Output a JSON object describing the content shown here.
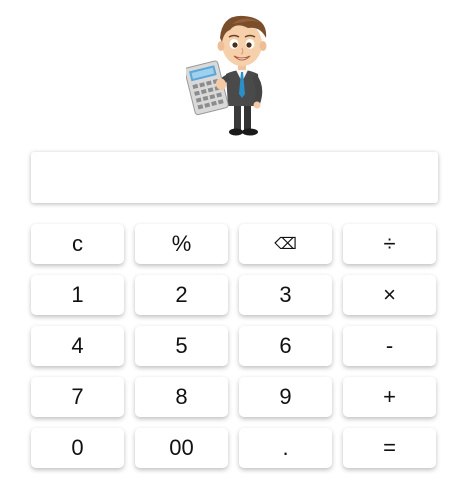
{
  "mascot": {
    "icon": "businessman-with-calculator-icon"
  },
  "display": {
    "value": ""
  },
  "keys": [
    {
      "label": "c",
      "name": "clear-button"
    },
    {
      "label": "%",
      "name": "percent-button"
    },
    {
      "label": "⌫",
      "name": "backspace-button"
    },
    {
      "label": "÷",
      "name": "divide-button"
    },
    {
      "label": "1",
      "name": "digit-1-button"
    },
    {
      "label": "2",
      "name": "digit-2-button"
    },
    {
      "label": "3",
      "name": "digit-3-button"
    },
    {
      "label": "×",
      "name": "multiply-button"
    },
    {
      "label": "4",
      "name": "digit-4-button"
    },
    {
      "label": "5",
      "name": "digit-5-button"
    },
    {
      "label": "6",
      "name": "digit-6-button"
    },
    {
      "label": "-",
      "name": "subtract-button"
    },
    {
      "label": "7",
      "name": "digit-7-button"
    },
    {
      "label": "8",
      "name": "digit-8-button"
    },
    {
      "label": "9",
      "name": "digit-9-button"
    },
    {
      "label": "+",
      "name": "add-button"
    },
    {
      "label": "0",
      "name": "digit-0-button"
    },
    {
      "label": "00",
      "name": "double-zero-button"
    },
    {
      "label": ".",
      "name": "decimal-point-button"
    },
    {
      "label": "=",
      "name": "equals-button"
    }
  ]
}
